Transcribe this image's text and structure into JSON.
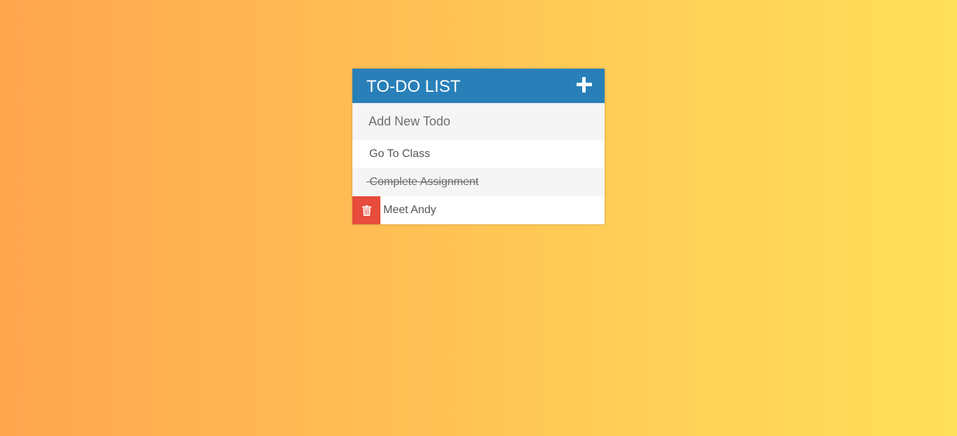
{
  "header": {
    "title": "TO-DO LIST"
  },
  "new_todo": {
    "placeholder": "Add New Todo",
    "value": ""
  },
  "todos": [
    {
      "text": "Go To Class",
      "completed": false
    },
    {
      "text": "Complete Assignment",
      "completed": true
    },
    {
      "text": "Meet Andy",
      "completed": false,
      "hovered": true
    }
  ],
  "icons": {
    "add": "plus-icon",
    "delete": "trash-icon"
  },
  "colors": {
    "header": "#2980b9",
    "delete": "#e74c3c",
    "gradient_start": "#ffa64f",
    "gradient_end": "#ffe05a"
  }
}
